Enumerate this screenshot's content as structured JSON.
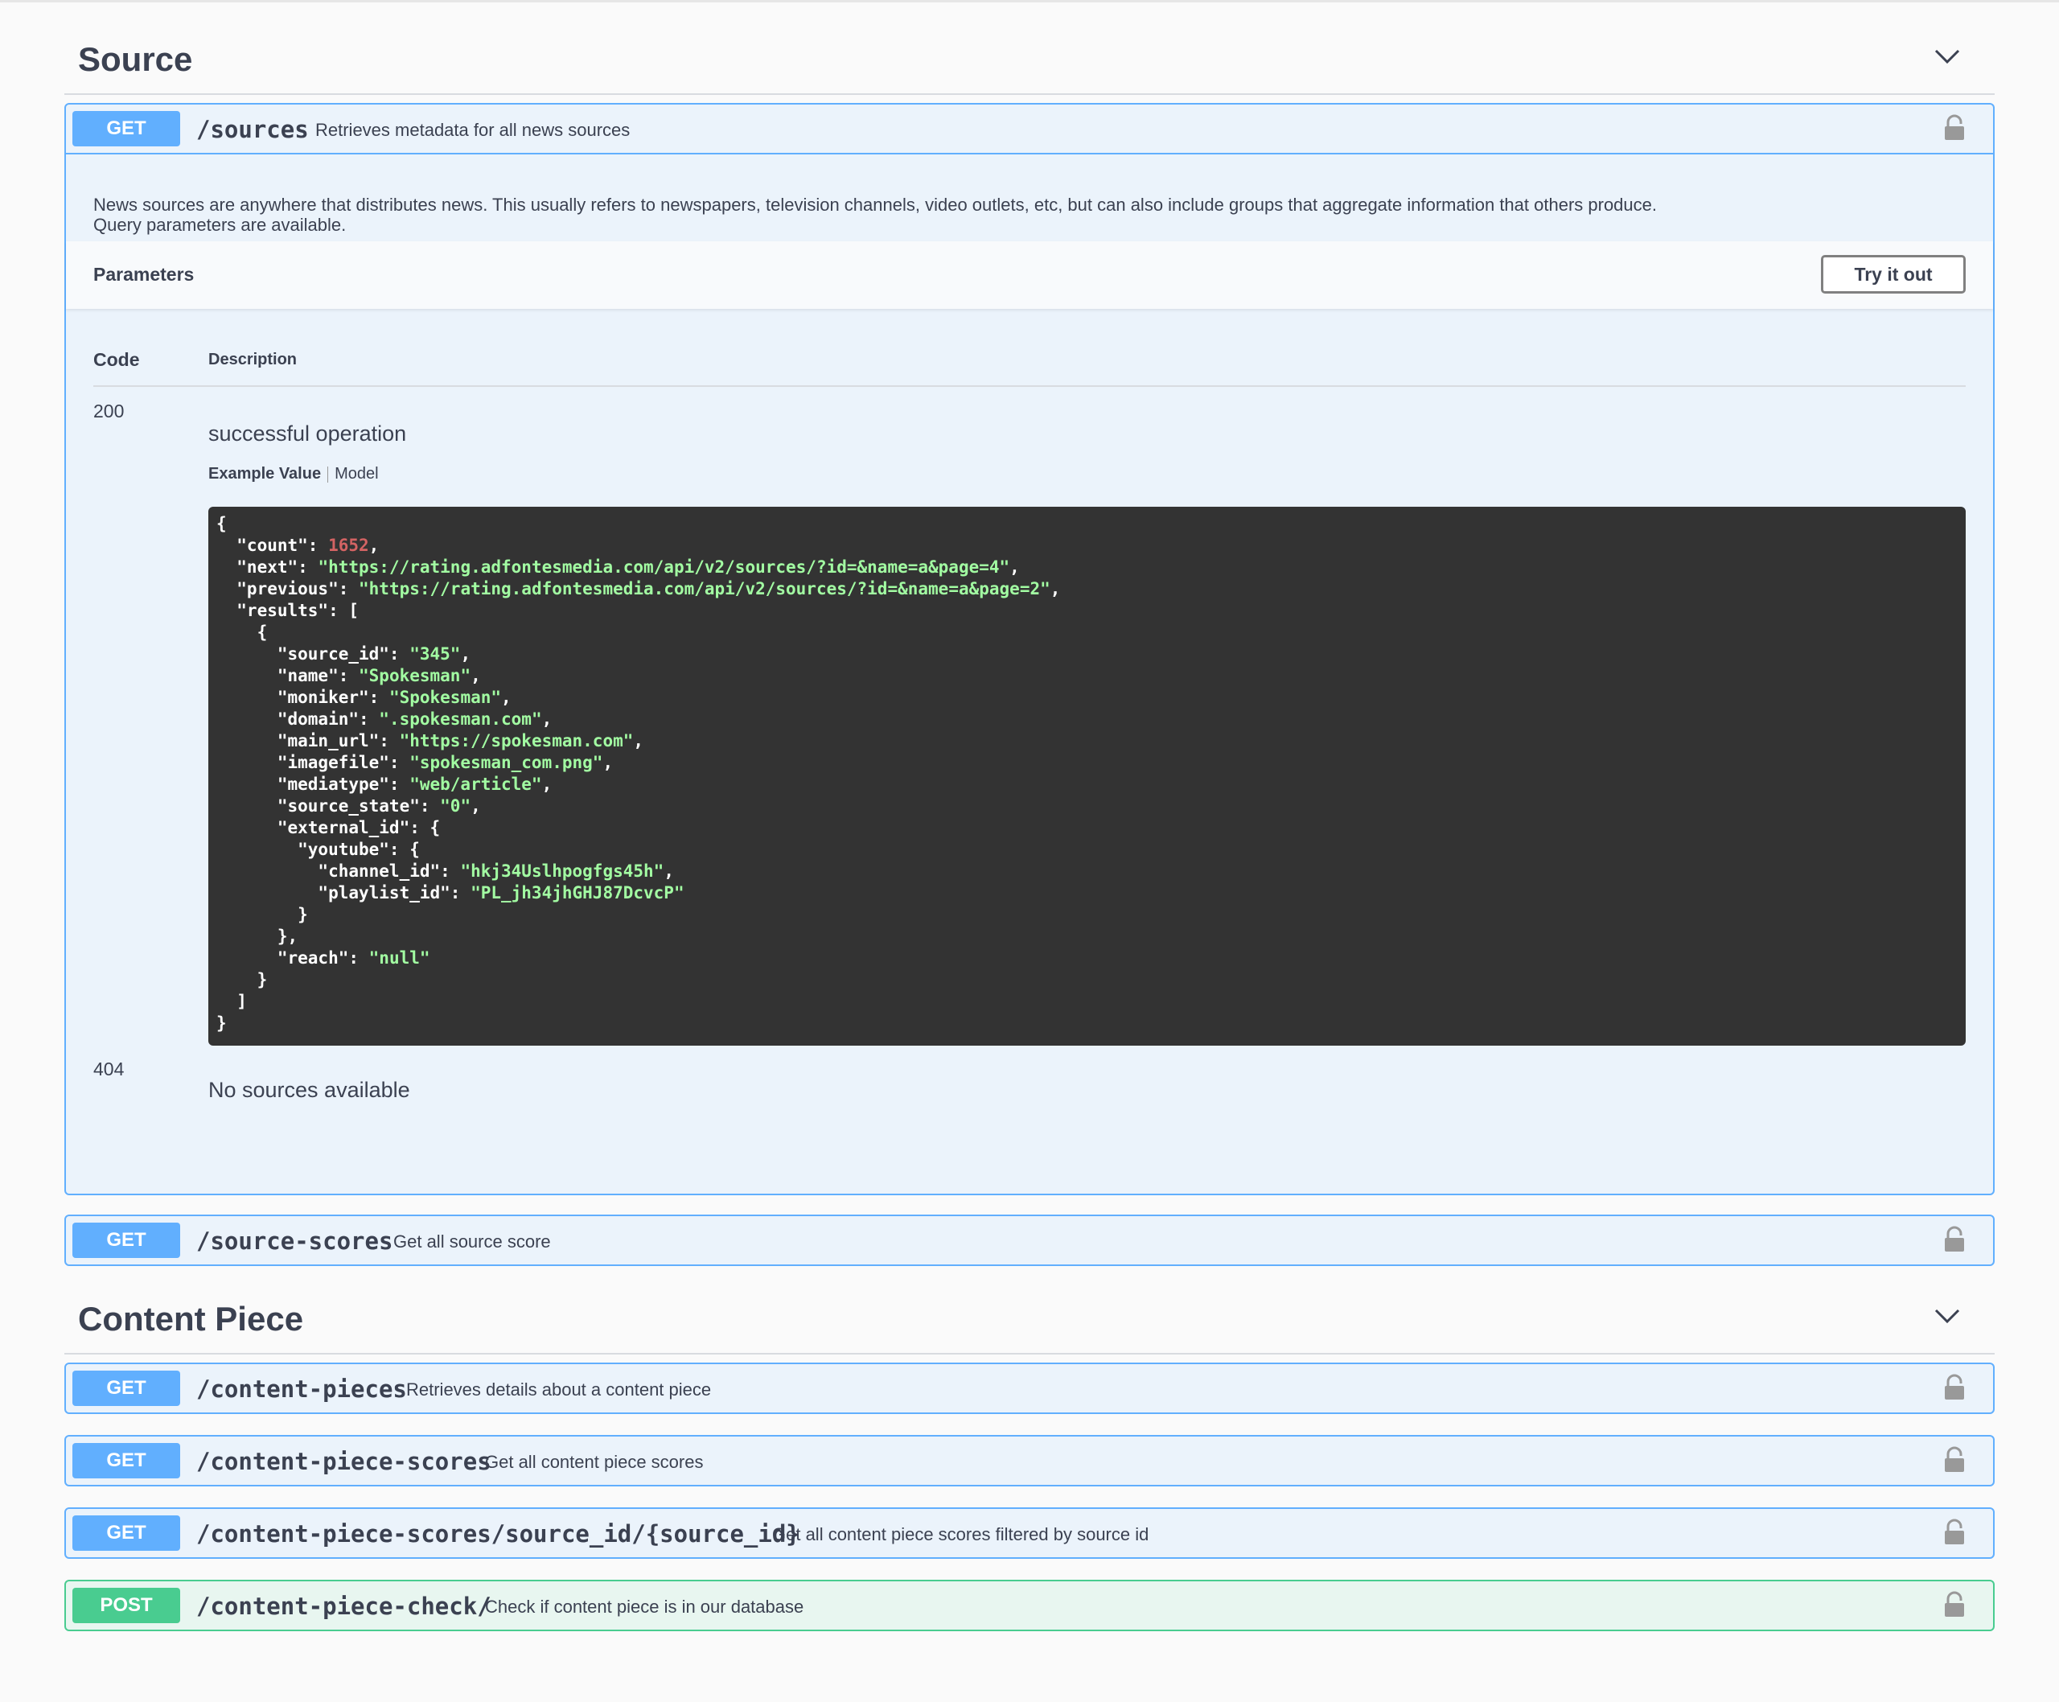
{
  "sections": [
    {
      "title": "Source"
    },
    {
      "title": "Content Piece"
    }
  ],
  "icons": {
    "chevron": "chevron-down-icon",
    "lock": "lock-icon"
  },
  "colors": {
    "get": "#61affe",
    "post": "#49cc90",
    "code_bg": "#333333",
    "string": "#a2fca2",
    "number": "#d36363"
  },
  "source_ops": [
    {
      "method": "GET",
      "path": "/sources",
      "summary": "Retrieves metadata for all news sources",
      "description_line1": "News sources are anywhere that distributes news. This usually refers to newspapers, television channels, video outlets, etc, but can also include groups that aggregate information that others produce.",
      "description_line2": "Query parameters are available.",
      "parameters_label": "Parameters",
      "try_label": "Try it out",
      "responses_code_header": "Code",
      "responses_desc_header": "Description",
      "responses": [
        {
          "code": "200",
          "description": "successful operation"
        },
        {
          "code": "404",
          "description": "No sources available"
        }
      ],
      "example_value_label": "Example Value",
      "model_label": "Model",
      "example": {
        "count": "1652",
        "next": "\"https://rating.adfontesmedia.com/api/v2/sources/?id=&name=a&page=4\"",
        "previous": "\"https://rating.adfontesmedia.com/api/v2/sources/?id=&name=a&page=2\"",
        "source_id": "\"345\"",
        "name": "\"Spokesman\"",
        "moniker": "\"Spokesman\"",
        "domain": "\".spokesman.com\"",
        "main_url": "\"https://spokesman.com\"",
        "imagefile": "\"spokesman_com.png\"",
        "mediatype": "\"web/article\"",
        "source_state": "\"0\"",
        "channel_id": "\"hkj34Uslhpogfgs45h\"",
        "playlist_id": "\"PL_jh34jhGHJ87DcvcP\"",
        "reach": "\"null\""
      }
    },
    {
      "method": "GET",
      "path": "/source-scores",
      "summary": "Get all source score"
    }
  ],
  "content_ops": [
    {
      "method": "GET",
      "path": "/content-pieces",
      "summary": "Retrieves details about a content piece"
    },
    {
      "method": "GET",
      "path": "/content-piece-scores",
      "summary": "Get all content piece scores"
    },
    {
      "method": "GET",
      "path": "/content-piece-scores/source_id/{source_id}",
      "summary": "Get all content piece scores filtered by source id"
    },
    {
      "method": "POST",
      "path": "/content-piece-check/",
      "summary": "Check if content piece is in our database"
    }
  ]
}
